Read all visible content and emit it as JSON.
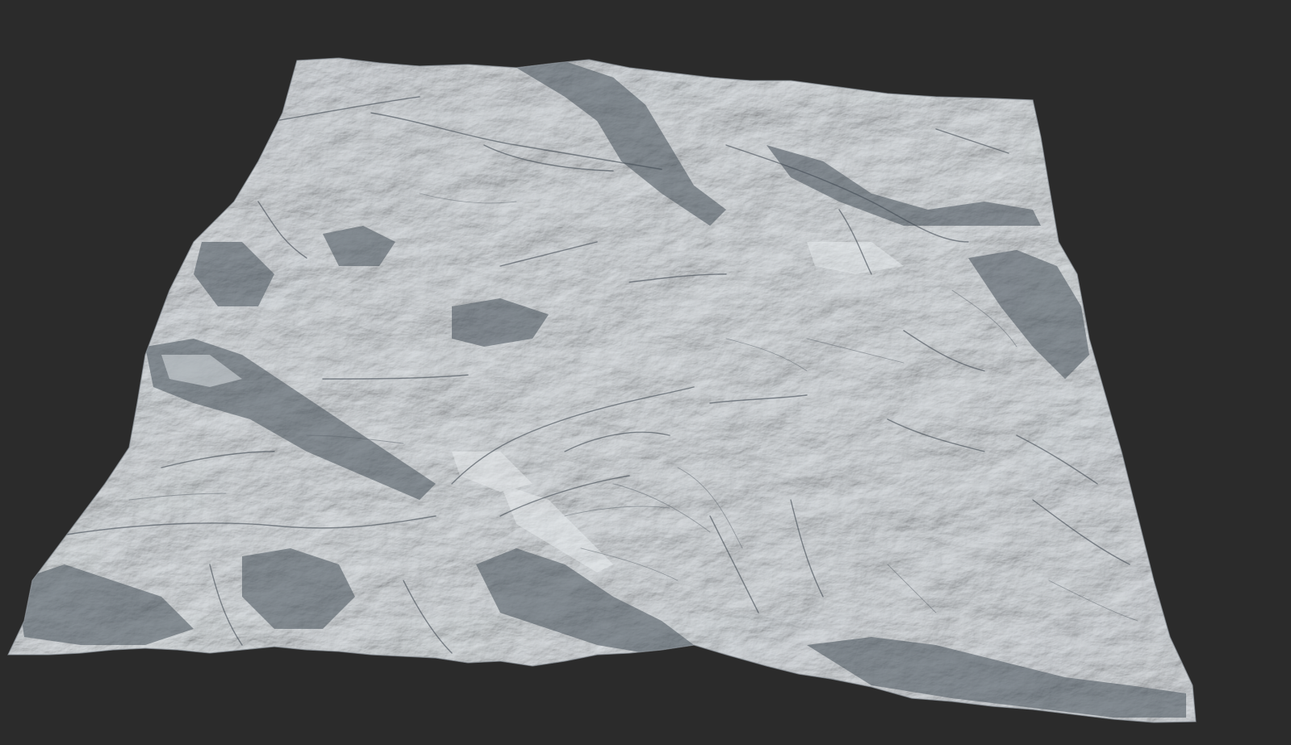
{
  "viewport": {
    "background_color": "#2b2b2b"
  },
  "terrain": {
    "description_kind": "3D heightmap render",
    "base_color": "#c9ced3",
    "highlight_color": "#e4e8eb",
    "shadow_color": "#3d4650",
    "ridge_color": "#5a636c"
  }
}
